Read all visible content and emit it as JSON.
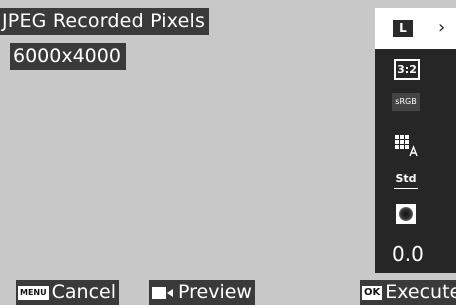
{
  "header": {
    "title": "JPEG Recorded Pixels",
    "value": "6000x4000"
  },
  "sidebar": {
    "selected_size_label": "L",
    "next_icon": "chevron-right-icon",
    "aspect_ratio_label": "3:2",
    "color_space_label": "sRGB",
    "quality_icon": "image-quality-grid-icon",
    "image_tone_label": "Std",
    "shading_icon": "vignette-dot-icon",
    "exposure_comp_value": "0.0"
  },
  "footer": {
    "cancel_key": "MENU",
    "cancel_label": "Cancel",
    "preview_icon": "camera-record-icon",
    "preview_label": "Preview",
    "execute_key": "OK",
    "execute_label": "Execute"
  },
  "colors": {
    "background": "#c8c8c8",
    "panel": "#262626",
    "label_bg": "#3a3a3a",
    "text": "#ffffff"
  }
}
